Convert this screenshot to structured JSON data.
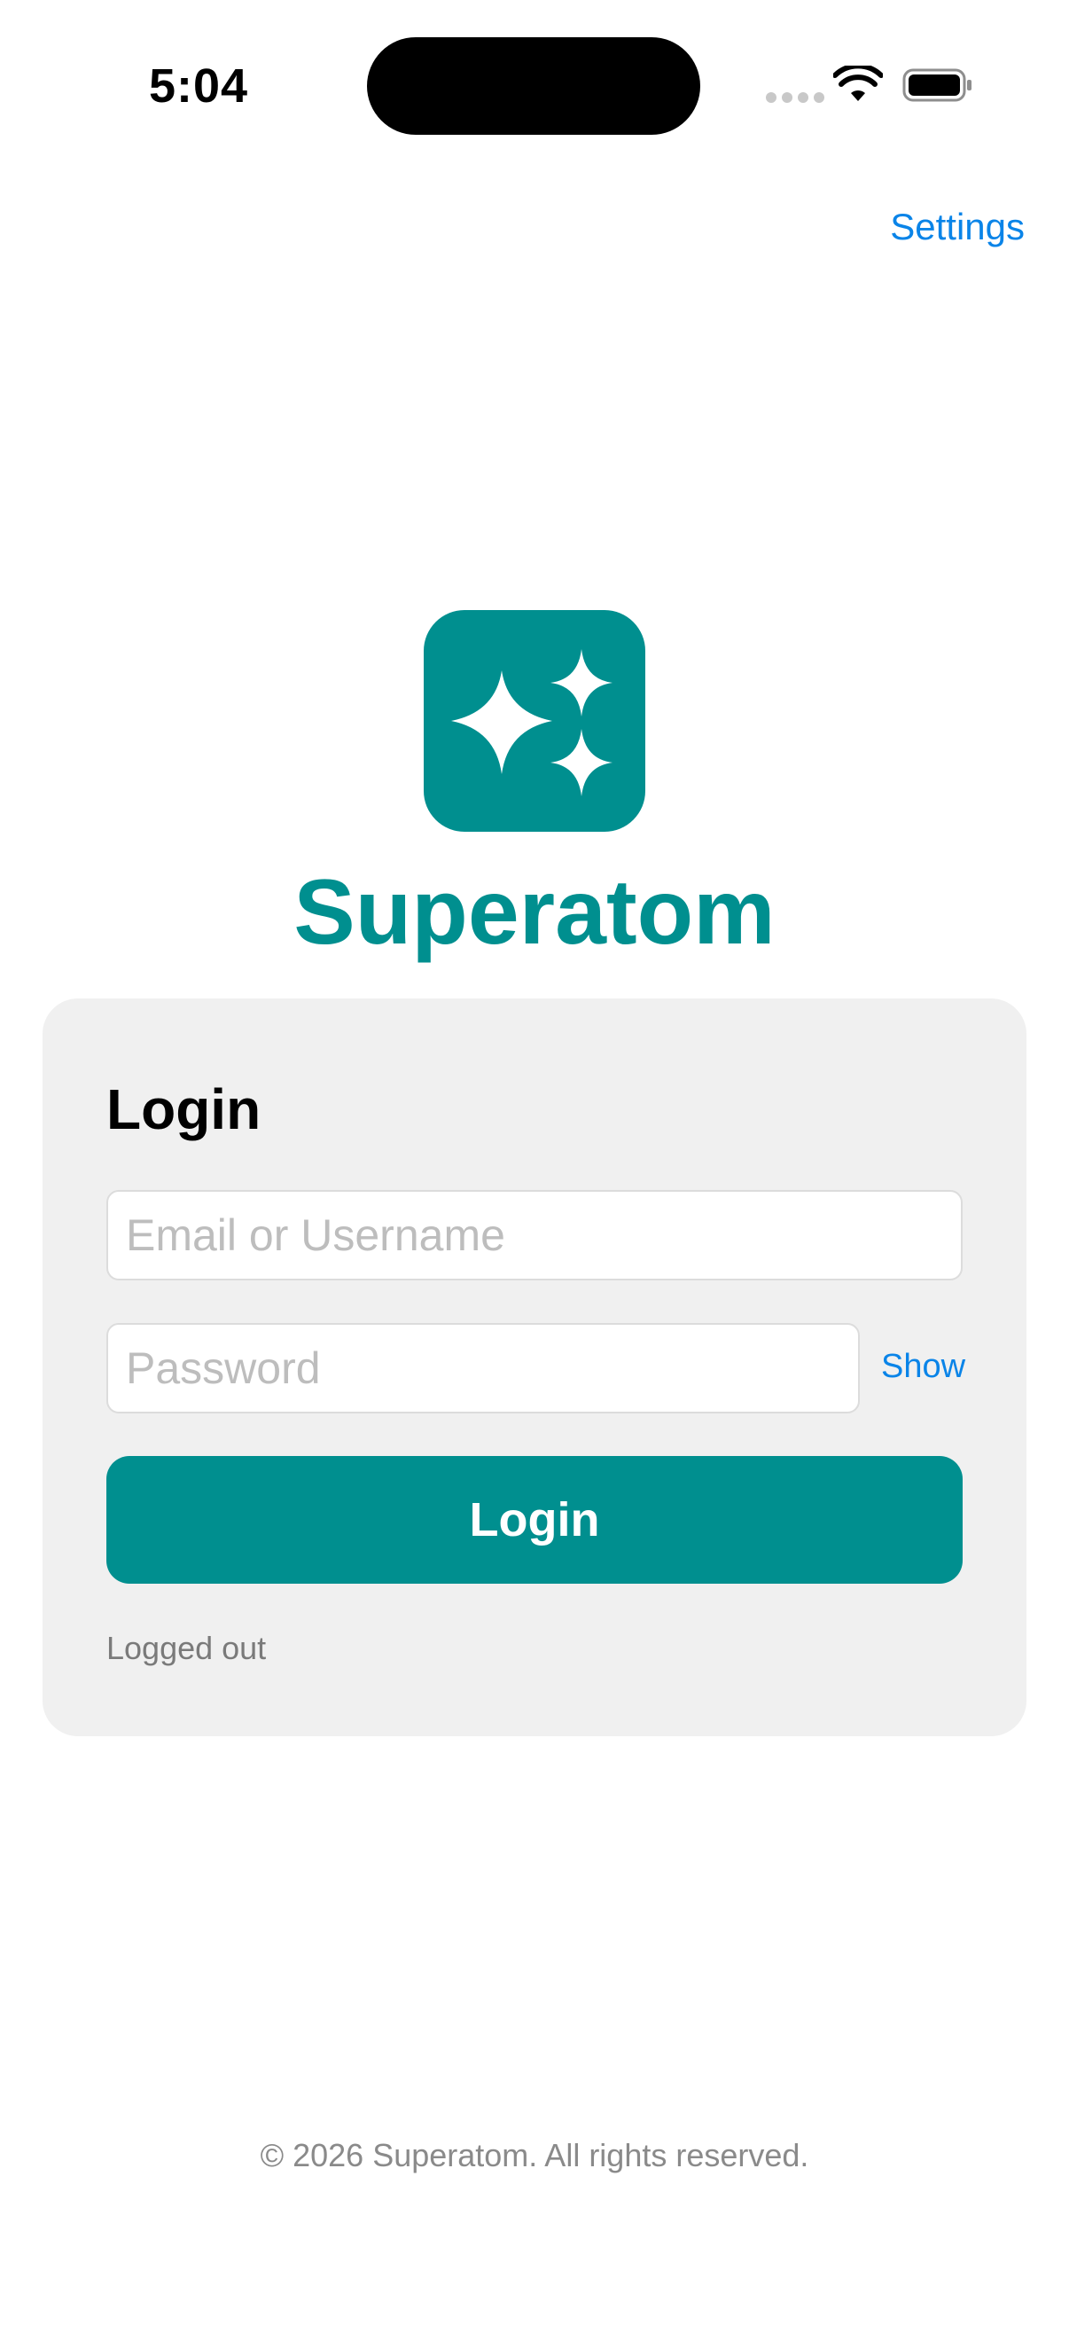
{
  "status_bar": {
    "time": "5:04"
  },
  "header": {
    "settings_label": "Settings"
  },
  "brand": {
    "name": "Superatom",
    "logo_icon": "sparkles-icon",
    "color": "#008f8f"
  },
  "login_card": {
    "title": "Login",
    "email_placeholder": "Email or Username",
    "password_placeholder": "Password",
    "show_label": "Show",
    "button_label": "Login",
    "status_text": "Logged out"
  },
  "footer": {
    "copyright": "© 2026 Superatom. All rights reserved."
  },
  "colors": {
    "accent": "#008f8f",
    "link": "#0a84e8",
    "card_bg": "#f0f0f0"
  }
}
